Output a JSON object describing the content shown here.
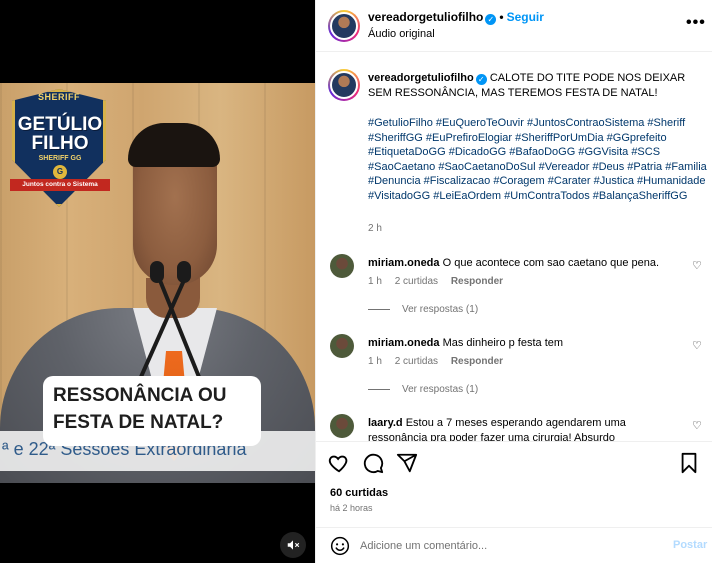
{
  "video": {
    "badge_top": "SHERIFF",
    "badge_line1": "GETÚLIO",
    "badge_line2": "FILHO",
    "badge_sub": "SHERIFF GG",
    "badge_letter": "G",
    "badge_ribbon": "Juntos contra o Sistema",
    "caption_line1": "RESSONÂNCIA OU",
    "caption_line2": "FESTA DE NATAL?",
    "session_text": "ª e 22ª Sessões Extraordinária",
    "mute_icon": "speaker-muted-icon"
  },
  "header": {
    "username": "vereadorgetuliofilho",
    "follow": "Seguir",
    "separator": "•",
    "audio": "Áudio original",
    "more": "•••"
  },
  "post": {
    "username": "vereadorgetuliofilho",
    "caption": "CALOTE DO TITE PODE NOS DEIXAR SEM RESSONÂNCIA, MAS TEREMOS FESTA DE NATAL!",
    "hashtags": "#GetulioFilho #EuQueroTeOuvir #JuntosContraoSistema #Sheriff #SheriffGG #EuPrefiroElogiar #SheriffPorUmDia #GGprefeito #EtiquetaDoGG #DicadoGG #BafaoDoGG #GGVisita #SCS #SaoCaetano #SaoCaetanoDoSul #Vereador #Deus #Patria #Familia #Denuncia #Fiscalizacao #Coragem #Carater #Justica #Humanidade #VisitadoGG #LeiEaOrdem #UmContraTodos #BalançaSheriffGG",
    "time": "2 h"
  },
  "comments": [
    {
      "user": "miriam.oneda",
      "text": "O que acontece com sao caetano que pena.",
      "time": "1 h",
      "likes": "2 curtidas",
      "reply": "Responder",
      "replies": "Ver respostas (1)"
    },
    {
      "user": "miriam.oneda",
      "text": "Mas dinheiro p festa tem",
      "time": "1 h",
      "likes": "2 curtidas",
      "reply": "Responder",
      "replies": "Ver respostas (1)"
    },
    {
      "user": "laary.d",
      "text": "Estou a 7 meses esperando agendarem uma ressonância pra poder fazer uma cirurgia! Absurdo"
    }
  ],
  "actions": {
    "likes": "60 curtidas",
    "ago": "há 2 horas"
  },
  "composer": {
    "placeholder": "Adicione um comentário...",
    "post": "Postar"
  },
  "colors": {
    "link": "#00376b",
    "accent": "#0095f6",
    "muted": "#737373"
  }
}
